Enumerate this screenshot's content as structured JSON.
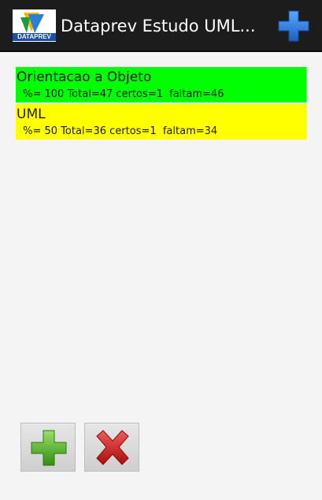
{
  "action_bar": {
    "logo_text": "DATAPREV",
    "title": "Dataprev Estudo UML...",
    "add_icon": "plus-icon"
  },
  "items": [
    {
      "name": "Orientacao a Objeto",
      "stats": " %= 100 Total=47 certos=1  faltam=46",
      "color": "#00ff00"
    },
    {
      "name": "UML",
      "stats": " %= 50 Total=36 certos=1  faltam=34",
      "color": "#ffff00"
    }
  ],
  "bottom_buttons": [
    {
      "icon": "green-plus-icon",
      "color": "#4caf1e"
    },
    {
      "icon": "red-x-icon",
      "color": "#d42020"
    }
  ],
  "colors": {
    "action_bar_bg": "#1c1c1c",
    "action_add_blue": "#2d7de0",
    "background": "#f4f4f4"
  }
}
